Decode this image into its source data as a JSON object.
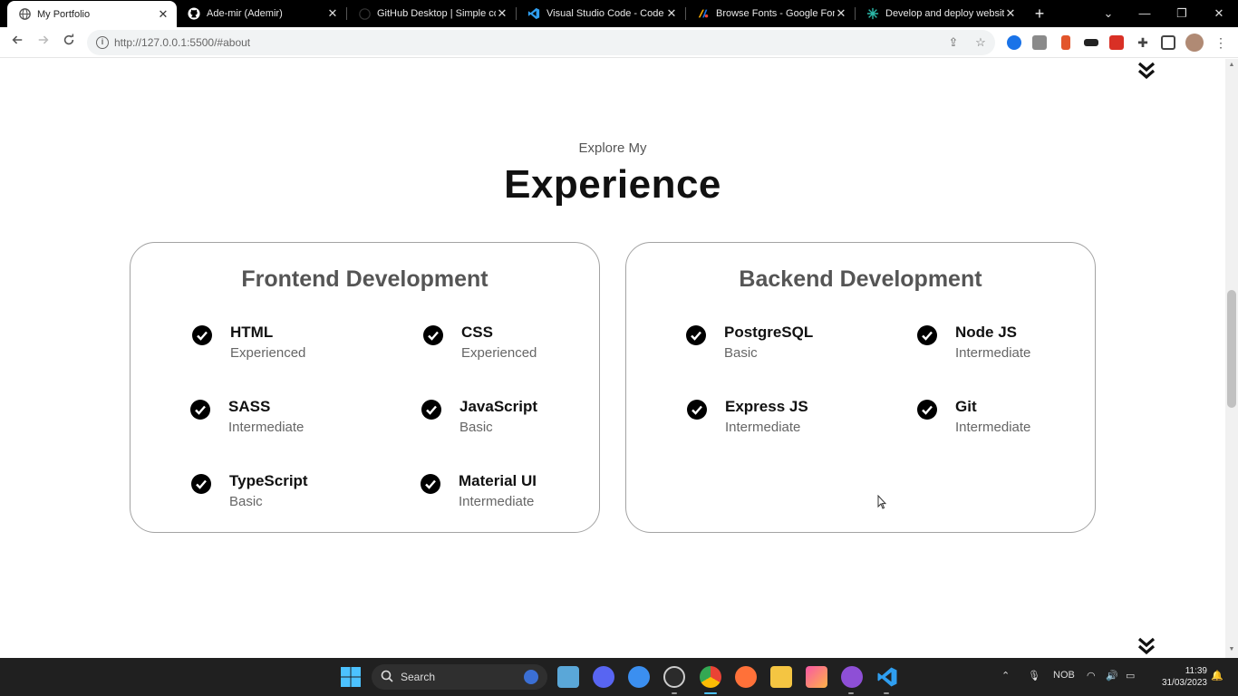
{
  "browser": {
    "tabs": [
      {
        "title": "My Portfolio",
        "active": true
      },
      {
        "title": "Ade-mir (Ademir)",
        "active": false
      },
      {
        "title": "GitHub Desktop | Simple co",
        "active": false
      },
      {
        "title": "Visual Studio Code - Code",
        "active": false
      },
      {
        "title": "Browse Fonts - Google Fon",
        "active": false
      },
      {
        "title": "Develop and deploy websit",
        "active": false
      }
    ],
    "url": "http://127.0.0.1:5500/#about"
  },
  "page": {
    "subtitle": "Explore My",
    "heading": "Experience",
    "cards": [
      {
        "title": "Frontend Development",
        "skills": [
          {
            "name": "HTML",
            "level": "Experienced"
          },
          {
            "name": "CSS",
            "level": "Experienced"
          },
          {
            "name": "SASS",
            "level": "Intermediate"
          },
          {
            "name": "JavaScript",
            "level": "Basic"
          },
          {
            "name": "TypeScript",
            "level": "Basic"
          },
          {
            "name": "Material UI",
            "level": "Intermediate"
          }
        ]
      },
      {
        "title": "Backend Development",
        "skills": [
          {
            "name": "PostgreSQL",
            "level": "Basic"
          },
          {
            "name": "Node JS",
            "level": "Intermediate"
          },
          {
            "name": "Express JS",
            "level": "Intermediate"
          },
          {
            "name": "Git",
            "level": "Intermediate"
          }
        ]
      }
    ]
  },
  "taskbar": {
    "search_label": "Search",
    "language": "NOB",
    "time": "11:39",
    "date": "31/03/2023"
  },
  "colors": {
    "tabstrip": "#000000",
    "taskbar": "#202020",
    "card_border": "#a3a3a3",
    "heading": "#111111"
  }
}
